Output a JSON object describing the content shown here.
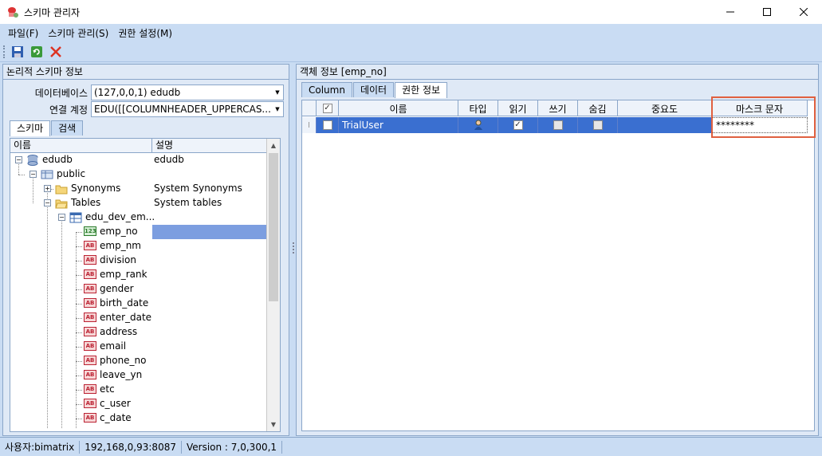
{
  "window": {
    "title": "스키마 관리자"
  },
  "menu": [
    "파일(F)",
    "스키마 관리(S)",
    "권한 설정(M)"
  ],
  "toolbar": {
    "save_icon": "save-icon",
    "refresh_icon": "refresh-icon",
    "delete_icon": "delete-icon"
  },
  "left": {
    "header": "논리적 스키마 정보",
    "database_label": "데이터베이스",
    "database_value": "(127,0,0,1) edudb",
    "connection_label": "연결 계정",
    "connection_value": "EDU([[COLUMNHEADER_UPPERCAS...",
    "tabs": [
      "스키마",
      "검색"
    ],
    "tree_headers": {
      "name": "이름",
      "desc": "설명"
    },
    "tree": [
      {
        "name": "edudb",
        "desc": "edudb"
      },
      {
        "name": "public",
        "desc": ""
      },
      {
        "name": "Synonyms",
        "desc": "System Synonyms"
      },
      {
        "name": "Tables",
        "desc": "System tables"
      },
      {
        "name": "edu_dev_em...",
        "desc": ""
      },
      {
        "name": "emp_no",
        "desc": ""
      },
      {
        "name": "emp_nm",
        "desc": ""
      },
      {
        "name": "division",
        "desc": ""
      },
      {
        "name": "emp_rank",
        "desc": ""
      },
      {
        "name": "gender",
        "desc": ""
      },
      {
        "name": "birth_date",
        "desc": ""
      },
      {
        "name": "enter_date",
        "desc": ""
      },
      {
        "name": "address",
        "desc": ""
      },
      {
        "name": "email",
        "desc": ""
      },
      {
        "name": "phone_no",
        "desc": ""
      },
      {
        "name": "leave_yn",
        "desc": ""
      },
      {
        "name": "etc",
        "desc": ""
      },
      {
        "name": "c_user",
        "desc": ""
      },
      {
        "name": "c_date",
        "desc": ""
      }
    ]
  },
  "right": {
    "header": "객체 정보  [emp_no]",
    "tabs": [
      "Column",
      "데이터",
      "권한 정보"
    ],
    "grid_headers": [
      "이름",
      "타입",
      "읽기",
      "쓰기",
      "숨김",
      "중요도",
      "마스크 문자"
    ],
    "row": {
      "name": "TrialUser",
      "mask": "********"
    }
  },
  "status": {
    "user": "사용자:bimatrix",
    "address": "192,168,0,93:8087",
    "version": "Version : 7,0,300,1"
  }
}
